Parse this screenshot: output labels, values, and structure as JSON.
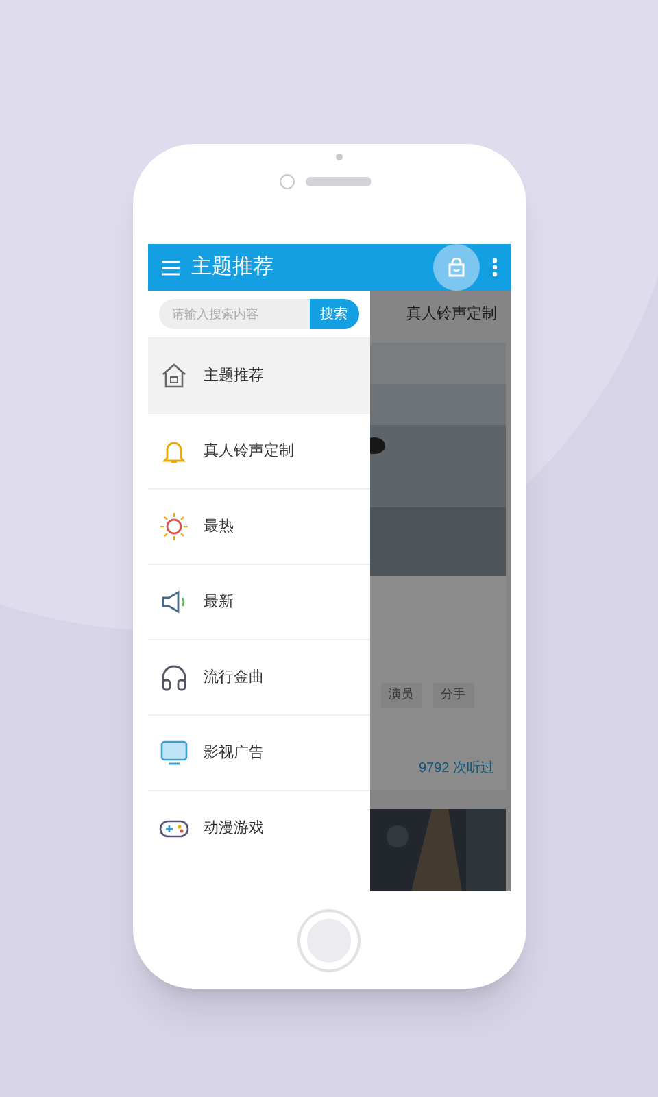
{
  "app_bar": {
    "title": "主题推荐"
  },
  "search": {
    "placeholder": "请输入搜索内容",
    "button": "搜索"
  },
  "menu": [
    {
      "kind": "home",
      "label": "主题推荐",
      "selected": true
    },
    {
      "kind": "bell",
      "label": "真人铃声定制",
      "selected": false
    },
    {
      "kind": "sun",
      "label": "最热",
      "selected": false
    },
    {
      "kind": "speaker",
      "label": "最新",
      "selected": false
    },
    {
      "kind": "headphones",
      "label": "流行金曲",
      "selected": false
    },
    {
      "kind": "tv",
      "label": "影视广告",
      "selected": false
    },
    {
      "kind": "gamepad",
      "label": "动漫游戏",
      "selected": false
    }
  ],
  "background_content": {
    "tab": "真人铃声定制",
    "tags": [
      "演员",
      "分手"
    ],
    "play_count": "9792 次听过"
  }
}
